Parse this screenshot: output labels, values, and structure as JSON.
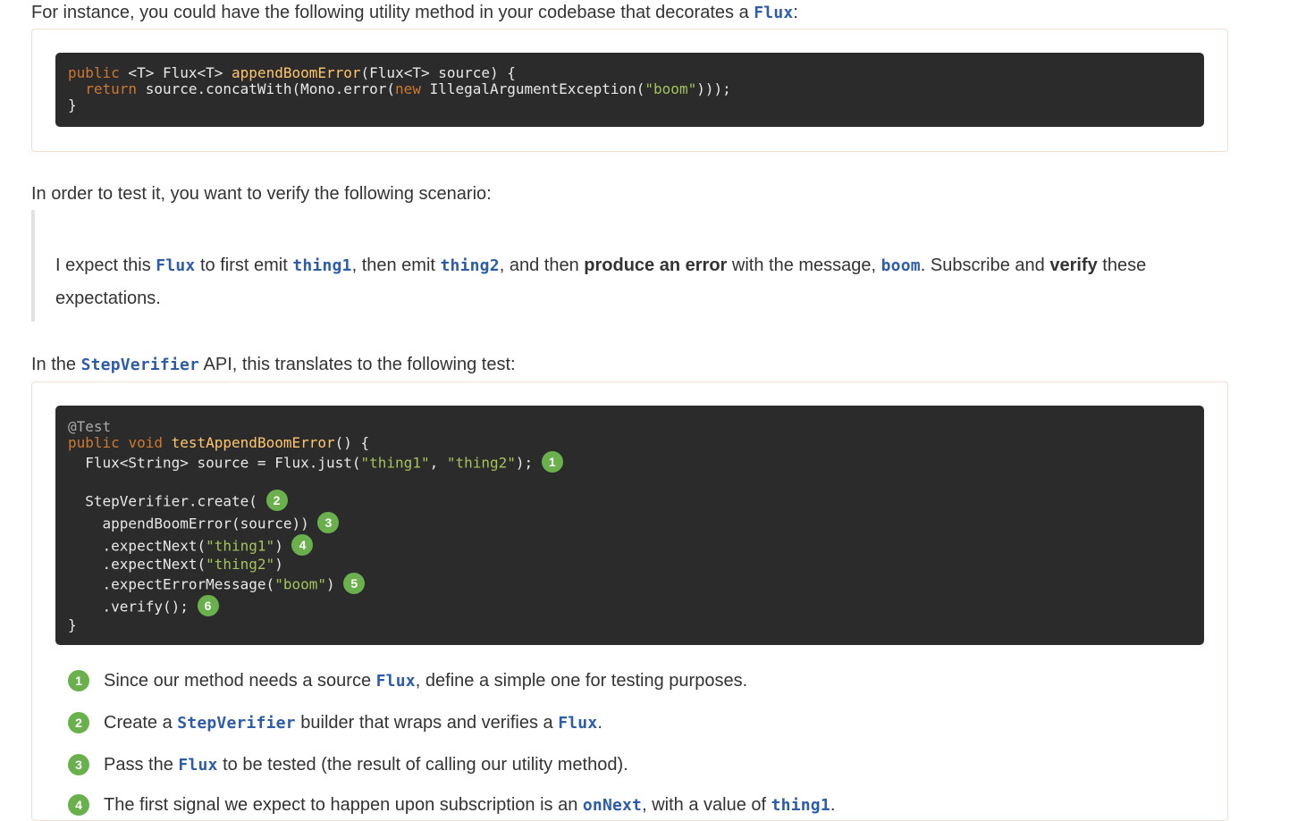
{
  "intro": {
    "before": "For instance, you could have the following utility method in your codebase that decorates a ",
    "code": "Flux",
    "after": ":"
  },
  "listing1": {
    "lines": [
      [
        "kw",
        "public"
      ],
      [
        "pl",
        " <T> Flux<T> "
      ],
      [
        "fn",
        "appendBoomError"
      ],
      [
        "pl",
        "(Flux<T> source) {"
      ]
    ],
    "line1": {
      "kw": "public",
      "mid": " <T> Flux<T> ",
      "fn": "appendBoomError",
      "end": "(Flux<T> source) {"
    },
    "line2": {
      "indent": "  ",
      "kw": "return",
      "mid": " source.concatWith(Mono.error(",
      "kw2": "new",
      "mid2": " IllegalArgumentException(",
      "str": "\"boom\"",
      "end": ")));"
    },
    "line3": "}"
  },
  "scenario_intro": "In order to test it, you want to verify the following scenario:",
  "quote": {
    "p1": "I expect this ",
    "c1": "Flux",
    "p2": " to first emit ",
    "c2": "thing1",
    "p3": ", then emit ",
    "c3": "thing2",
    "p4": ", and then ",
    "b1": "produce an error",
    "p5": " with the message, ",
    "c4": "boom",
    "p6": ". Subscribe and ",
    "b2": "verify",
    "p7": " these expectations."
  },
  "api_intro": {
    "before": "In the ",
    "code": "StepVerifier",
    "after": " API, this translates to the following test:"
  },
  "listing2": {
    "l1": "@Test",
    "l2": {
      "kw1": "public",
      "sp": " ",
      "kw2": "void",
      "sp2": " ",
      "fn": "testAppendBoomError",
      "end": "() {"
    },
    "l3": {
      "pre": "  Flux<String> source = Flux.just(",
      "s1": "\"thing1\"",
      "mid": ", ",
      "s2": "\"thing2\"",
      "end": ");"
    },
    "l4": "  StepVerifier.create(",
    "l5": "    appendBoomError(source))",
    "l6": {
      "pre": "    .expectNext(",
      "s": "\"thing1\"",
      "end": ")"
    },
    "l7": {
      "pre": "    .expectNext(",
      "s": "\"thing2\"",
      "end": ")"
    },
    "l8": {
      "pre": "    .expectErrorMessage(",
      "s": "\"boom\"",
      "end": ")"
    },
    "l9": "    .verify();",
    "l10": "}",
    "callouts": [
      "1",
      "2",
      "3",
      "4",
      "5",
      "6"
    ]
  },
  "colist": [
    {
      "num": "1",
      "a": "Since our method needs a source ",
      "code": "Flux",
      "b": ", define a simple one for testing purposes."
    },
    {
      "num": "2",
      "a": "Create a ",
      "code": "StepVerifier",
      "b": " builder that wraps and verifies a ",
      "code2": "Flux",
      "c": "."
    },
    {
      "num": "3",
      "a": "Pass the ",
      "code": "Flux",
      "b": " to be tested (the result of calling our utility method)."
    },
    {
      "num": "4",
      "a": "The first signal we expect to happen upon subscription is an ",
      "code": "onNext",
      "b": ", with a value of ",
      "code2": "thing1",
      "c": "."
    }
  ]
}
